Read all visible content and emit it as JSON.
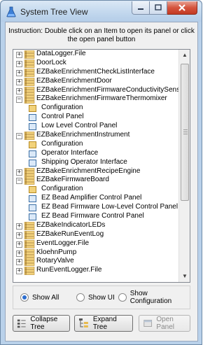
{
  "window": {
    "title": "System Tree View"
  },
  "instruction": "Instruction: Double click on an Item to open its panel or click the open panel button",
  "tree": [
    {
      "label": "DataLogger.File",
      "kind": "group",
      "expanded": false,
      "depth": 0
    },
    {
      "label": "DoorLock",
      "kind": "group",
      "expanded": false,
      "depth": 0
    },
    {
      "label": "EZBakeEnrichmentCheckListInterface",
      "kind": "group",
      "expanded": false,
      "depth": 0
    },
    {
      "label": "EZBakeEnrichmentDoor",
      "kind": "group",
      "expanded": false,
      "depth": 0
    },
    {
      "label": "EZBakeEnrichmentFirmwareConductivitySensor",
      "kind": "group",
      "expanded": false,
      "depth": 0
    },
    {
      "label": "EZBakeEnrichmentFirmwareThermomixer",
      "kind": "group",
      "expanded": true,
      "depth": 0
    },
    {
      "label": "Configuration",
      "kind": "config",
      "depth": 1
    },
    {
      "label": "Control Panel",
      "kind": "panel",
      "depth": 1
    },
    {
      "label": "Low Level Control Panel",
      "kind": "panel",
      "depth": 1
    },
    {
      "label": "EZBakeEnrichmentInstrument",
      "kind": "group",
      "expanded": true,
      "depth": 0
    },
    {
      "label": "Configuration",
      "kind": "config",
      "depth": 1
    },
    {
      "label": "Operator Interface",
      "kind": "panel",
      "depth": 1
    },
    {
      "label": "Shipping Operator Interface",
      "kind": "panel",
      "depth": 1
    },
    {
      "label": "EZBakeEnrichmentRecipeEngine",
      "kind": "group",
      "expanded": false,
      "depth": 0
    },
    {
      "label": "EZBakeFirmwareBoard",
      "kind": "group",
      "expanded": true,
      "depth": 0
    },
    {
      "label": "Configuration",
      "kind": "config",
      "depth": 1
    },
    {
      "label": "EZ Bead Amplifier Control Panel",
      "kind": "panel",
      "depth": 1
    },
    {
      "label": "EZ Bead Firmware Low-Level Control Panel",
      "kind": "panel",
      "depth": 1
    },
    {
      "label": "EZ Bead Firmware Control Panel",
      "kind": "panel",
      "depth": 1
    },
    {
      "label": "EZBakeIndicatorLEDs",
      "kind": "group",
      "expanded": false,
      "depth": 0
    },
    {
      "label": "EZBakeRunEventLog",
      "kind": "group",
      "expanded": false,
      "depth": 0
    },
    {
      "label": "EventLogger.File",
      "kind": "group",
      "expanded": false,
      "depth": 0
    },
    {
      "label": "KloehnPump",
      "kind": "group",
      "expanded": false,
      "depth": 0
    },
    {
      "label": "RotaryValve",
      "kind": "group",
      "expanded": false,
      "depth": 0
    },
    {
      "label": "RunEventLogger.File",
      "kind": "group",
      "expanded": false,
      "depth": 0
    }
  ],
  "scrollbar": {
    "up": "▲",
    "down": "▼"
  },
  "filters": {
    "options": [
      {
        "label": "Show All",
        "checked": true
      },
      {
        "label": "Show UI",
        "checked": false
      },
      {
        "label": "Show Configuration",
        "checked": false
      }
    ]
  },
  "buttons": {
    "collapse": "Collapse Tree",
    "expand": "Expand Tree",
    "open_panel": "Open Panel"
  },
  "colors": {
    "window_frame": "#b9d1ea",
    "close_button": "#c23a22",
    "folder": "#e7b94b",
    "radio_selected": "#2d6ecf"
  },
  "icons": {
    "app": "flask-icon",
    "group": "folder-stack-icon",
    "config": "configuration-icon",
    "panel": "panel-icon",
    "collapse": "collapse-tree-icon",
    "expand": "expand-tree-icon",
    "open": "open-panel-icon"
  }
}
